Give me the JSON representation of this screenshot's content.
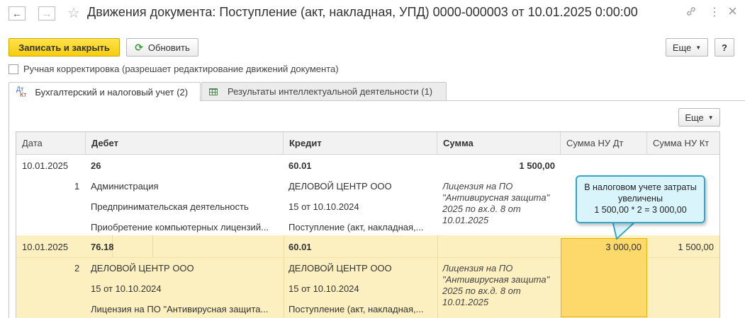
{
  "header": {
    "back_icon": "←",
    "forward_icon": "→",
    "star_icon": "☆",
    "title": "Движения документа: Поступление (акт, накладная, УПД) 0000-000003 от 10.01.2025 0:00:00",
    "link_icon": "🔗",
    "more_icon": "⋮",
    "close_icon": "×"
  },
  "toolbar": {
    "save_close_label": "Записать и закрыть",
    "refresh_label": "Обновить",
    "more_label": "Еще",
    "help_label": "?"
  },
  "manual": {
    "label": "Ручная корректировка (разрешает редактирование движений документа)"
  },
  "tabs": [
    {
      "label": "Бухгалтерский и налоговый учет (2)",
      "icon_top": "Дт",
      "icon_bottom": "Кт"
    },
    {
      "label": "Результаты интеллектуальной деятельности (1)"
    }
  ],
  "panel": {
    "more_label": "Еще"
  },
  "table": {
    "columns": [
      "Дата",
      "Дебет",
      "Кредит",
      "Сумма",
      "Сумма НУ Дт",
      "Сумма НУ Кт"
    ],
    "rows": [
      {
        "date": "10.01.2025",
        "num": "1",
        "debit_account": "26",
        "debit_sub": [
          "Администрация",
          "Предпринимательская деятельность",
          "Приобретение компьютерных лицензий..."
        ],
        "credit_account": "60.01",
        "credit_sub": [
          "ДЕЛОВОЙ ЦЕНТР ООО",
          "15 от 10.10.2024",
          "Поступление (акт, накладная,..."
        ],
        "amount": "1 500,00",
        "content": "Лицензия на ПО \"Антивирусная защита\" 2025 по вх.д. 8 от 10.01.2025",
        "nu_dt": "",
        "nu_kt": ""
      },
      {
        "date": "10.01.2025",
        "num": "2",
        "debit_account": "76.18",
        "debit_sub": [
          "ДЕЛОВОЙ ЦЕНТР ООО",
          "15 от 10.10.2024",
          "Лицензия на ПО \"Антивирусная защита..."
        ],
        "credit_account": "60.01",
        "credit_sub": [
          "ДЕЛОВОЙ ЦЕНТР ООО",
          "15 от 10.10.2024",
          "Поступление (акт, накладная,..."
        ],
        "amount": "",
        "content": "Лицензия на ПО \"Антивирусная защита\" 2025 по вх.д. 8 от 10.01.2025",
        "nu_dt": "3 000,00",
        "nu_kt": "1 500,00"
      }
    ]
  },
  "callout": {
    "line1": "В налоговом учете затраты",
    "line2": "увеличены",
    "line3": "1 500,00 * 2 = 3 000,00"
  },
  "colors": {
    "primary_button": "#f5cc0d",
    "row_highlight": "#fdf0c0",
    "cell_highlight": "#fcd96a",
    "callout_bg": "#d9f4fb",
    "callout_border": "#34a7c9"
  }
}
